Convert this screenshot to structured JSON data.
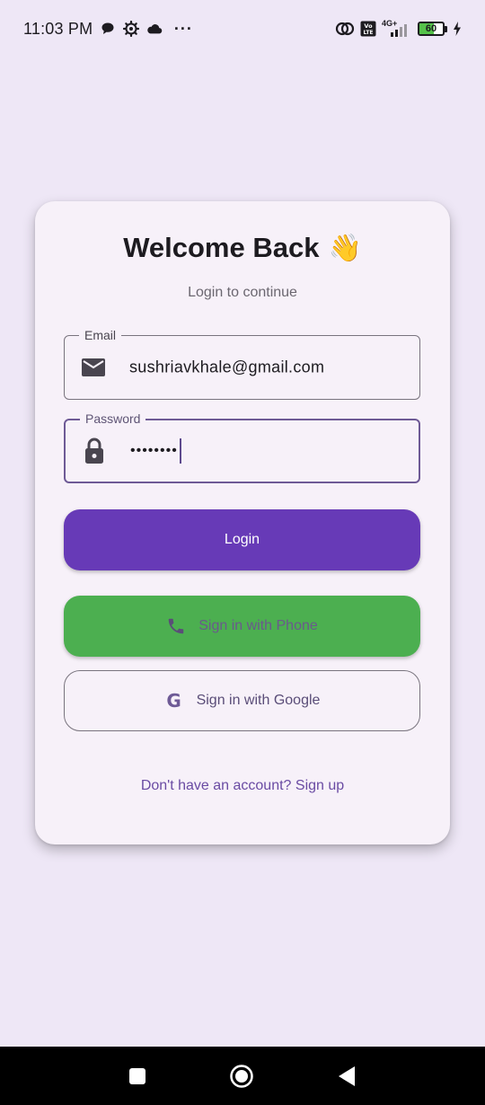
{
  "status_bar": {
    "time": "11:03 PM",
    "left_icons": [
      "chat-bubble-icon",
      "gear-icon",
      "cloud-icon",
      "more-dots-icon"
    ],
    "right_icons": [
      "hotspot-icon",
      "volte-icon",
      "signal-4g-icon",
      "battery-icon",
      "charging-icon"
    ],
    "network_label": "4G+",
    "volte_label": "Vo LTE",
    "battery_level": "60",
    "more_label": "···"
  },
  "login": {
    "title": "Welcome Back",
    "title_emoji": "👋",
    "subtitle": "Login to continue",
    "email": {
      "label": "Email",
      "value": "sushriavkhale@gmail.com",
      "icon": "mail-icon"
    },
    "password": {
      "label": "Password",
      "value": "••••••••",
      "icon": "lock-icon"
    },
    "login_button": "Login",
    "phone_button": "Sign in with Phone",
    "google_button": "Sign in with Google",
    "google_glyph": "G",
    "signup_link": "Don't have an account? Sign up"
  },
  "colors": {
    "background": "#EEE7F6",
    "card": "#F7F1F9",
    "primary": "#673AB7",
    "phone_button": "#4CAF50",
    "link": "#6A4BA3"
  },
  "nav_bar": {
    "buttons": [
      "recent-apps-icon",
      "home-icon",
      "back-icon"
    ]
  }
}
